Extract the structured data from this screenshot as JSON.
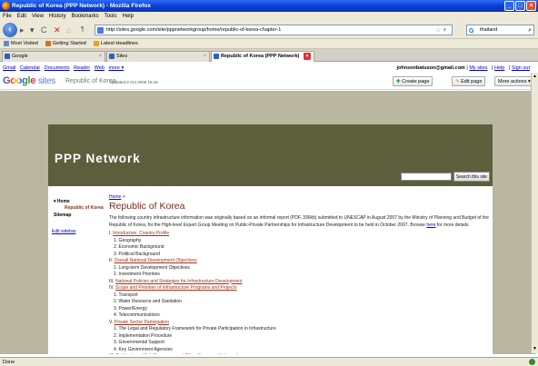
{
  "window": {
    "title": "Republic of Korea (PPP Network) - Mozilla Firefox"
  },
  "menu": [
    "File",
    "Edit",
    "View",
    "History",
    "Bookmarks",
    "Tools",
    "Help"
  ],
  "nav": {
    "url": "http://sites.google.com/site/pppnetworkgroup/home/republic-of-korea-chapter-1",
    "search_value": "thailand"
  },
  "bookmarks": [
    "Most Visited",
    "Getting Started",
    "Latest Headlines"
  ],
  "tabs": [
    "Google",
    "Sites",
    "Republic of Korea (PPP Network)"
  ],
  "google_bar": {
    "links": [
      "Gmail",
      "Calendar",
      "Documents",
      "Reader",
      "Web",
      "more ▾"
    ],
    "user": "johnsonbatuson@gmail.com",
    "right_links": [
      "My sites",
      "Help",
      "Sign out"
    ]
  },
  "site_header": {
    "logo_google": "Google",
    "logo_sites": "sites",
    "site_name": "Republic of Korea",
    "updated": "Updated 9 Oct 2008 15:46",
    "buttons": [
      "Create page",
      "Edit page",
      "More actions ▾"
    ]
  },
  "banner": {
    "title": "PPP Network",
    "search_button": "Search this site"
  },
  "sidebar": {
    "home": "▾ Home",
    "current": "Republic of Korea",
    "sitemap": "Sitemap",
    "edit": "Edit sidebar"
  },
  "breadcrumb": {
    "home": "Home",
    "sep": " >"
  },
  "page_title": "Republic of Korea",
  "intro": {
    "before": "The following country infrastructure information was originally based on an informal report (PDF, 336kb) submitted to UNESCAP in August 2007 by the Ministry of Planning and Budget of the Republic of Korea, for the High-level Expert Group Meeting on Public-Private Partnerships for Infrastructure Development to be held in October 2007. Browse ",
    "link": "here",
    "after": " for more details."
  },
  "toc": [
    {
      "num": "I.",
      "title": "Introduction: Country Profile",
      "items": [
        "1. Geography",
        "2. Economic Background",
        "3. Political Background"
      ]
    },
    {
      "num": "II.",
      "title": "Overall National Development Objectives",
      "items": [
        "1. Long-term Development Objectives",
        "2. Investment Priorities"
      ]
    },
    {
      "num": "III.",
      "title": "National Policies and Strategies for Infrastructure Development",
      "items": []
    },
    {
      "num": "IV.",
      "title": "Scope and Priorities of Infrastructure Programs and Projects",
      "items": [
        "1. Transport",
        "2. Water Resource and Sanitation",
        "3. Power/Energy",
        "4. Telecommunications"
      ]
    },
    {
      "num": "V.",
      "title": "Private Sector Participation",
      "items": [
        "1. The Legal and Regulatory Framework for Private Participation in Infrastructure",
        "2. Implementation Procedure",
        "3. Governmental Support",
        "4. Key Government Agencies"
      ]
    },
    {
      "num": "VI.",
      "title": "Publications, Web Resources and Other Sources of Information",
      "items": []
    }
  ],
  "status": "Done"
}
